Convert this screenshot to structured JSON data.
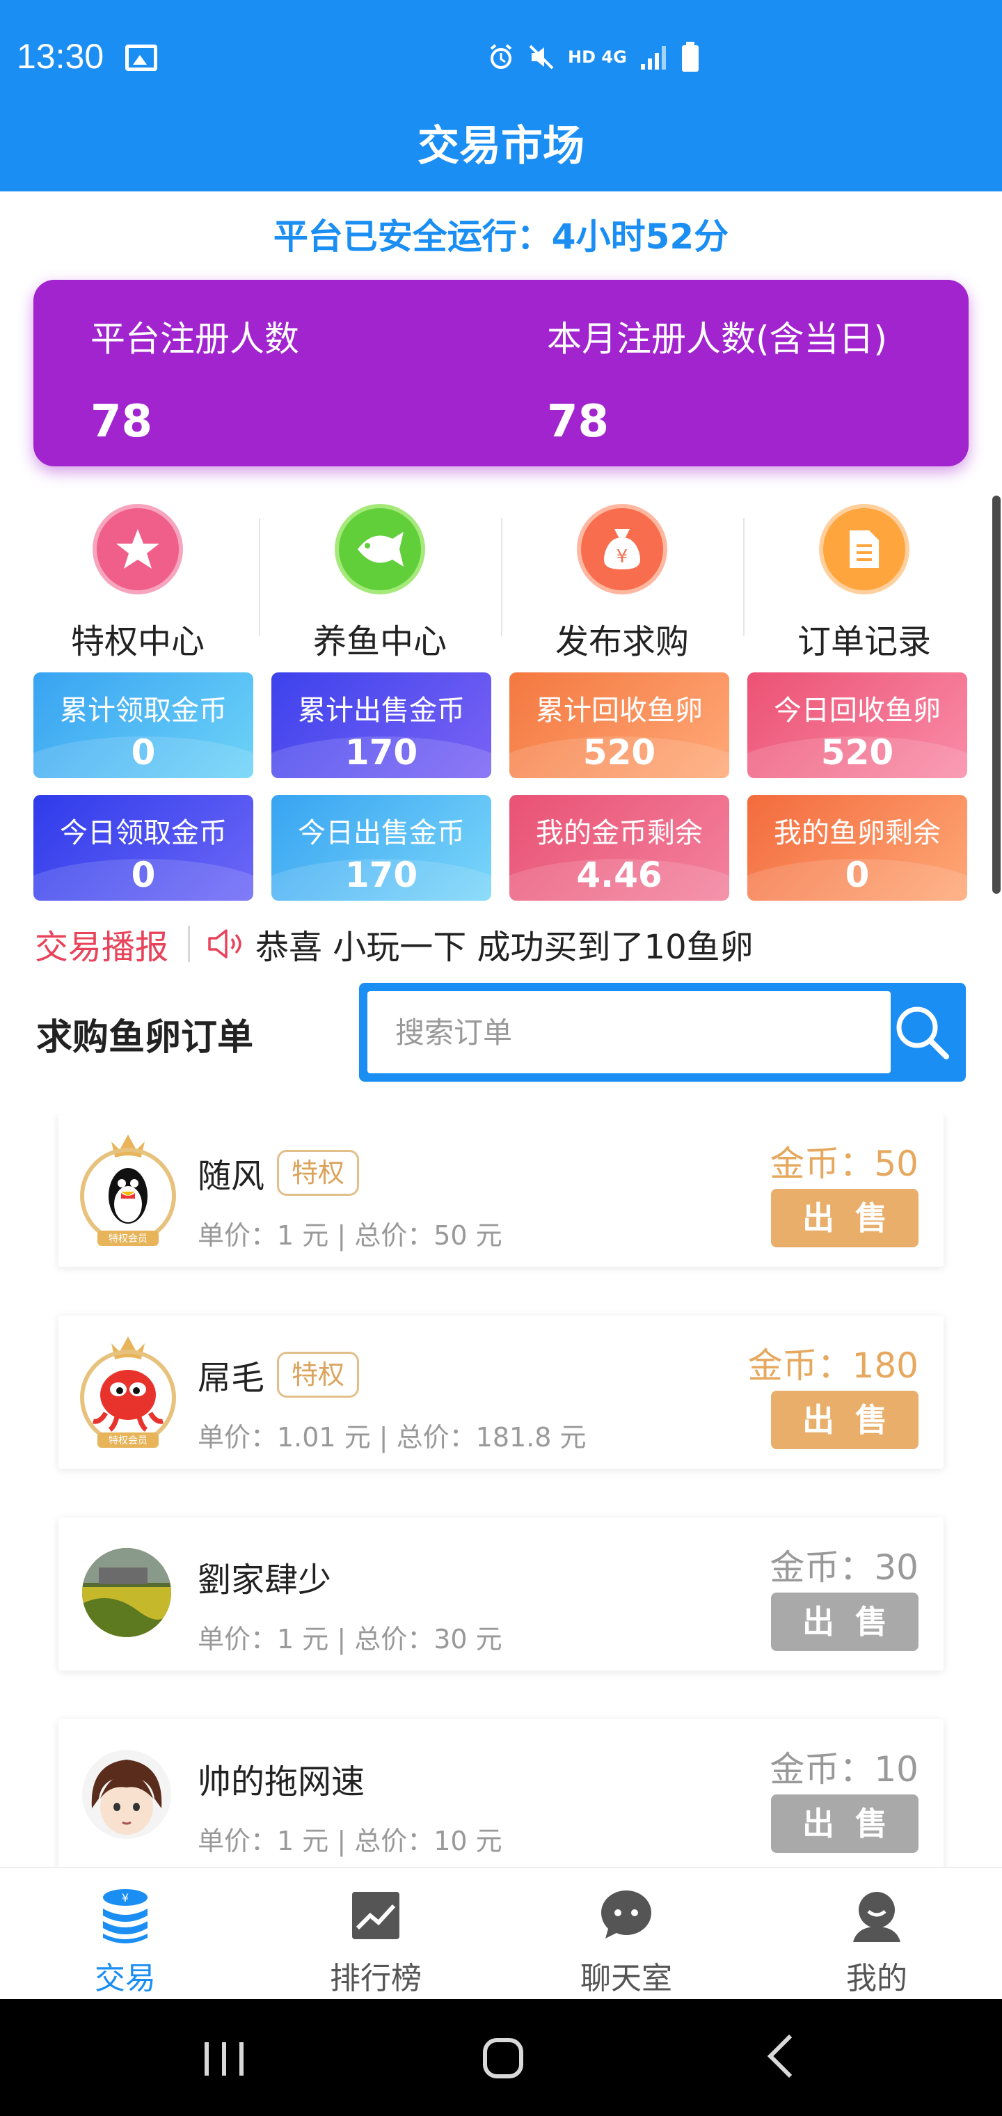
{
  "status_bar": {
    "time": "13:30",
    "network": "HD 4G"
  },
  "header": {
    "title": "交易市场"
  },
  "runtime": {
    "text": "平台已安全运行：4小时52分"
  },
  "stats": {
    "total_label": "平台注册人数",
    "total_value": "78",
    "month_label": "本月注册人数(含当日)",
    "month_value": "78"
  },
  "quick_nav": [
    {
      "label": "特权中心",
      "icon": "star-icon",
      "color": "#ef5f8a"
    },
    {
      "label": "养鱼中心",
      "icon": "fish-icon",
      "color": "#61cf3a"
    },
    {
      "label": "发布求购",
      "icon": "money-bag-icon",
      "color": "#f76d4e"
    },
    {
      "label": "订单记录",
      "icon": "document-icon",
      "color": "#ffa53d"
    }
  ],
  "tiles": [
    {
      "label": "累计领取金币",
      "value": "0"
    },
    {
      "label": "累计出售金币",
      "value": "170"
    },
    {
      "label": "累计回收鱼卵",
      "value": "520"
    },
    {
      "label": "今日回收鱼卵",
      "value": "520"
    },
    {
      "label": "今日领取金币",
      "value": "0"
    },
    {
      "label": "今日出售金币",
      "value": "170"
    },
    {
      "label": "我的金币剩余",
      "value": "4.46"
    },
    {
      "label": "我的鱼卵剩余",
      "value": "0"
    }
  ],
  "broadcast": {
    "title": "交易播报",
    "message": "恭喜 小玩一下 成功买到了10鱼卵"
  },
  "orders_section": {
    "title": "求购鱼卵订单",
    "search_placeholder": "搜索订单"
  },
  "orders": [
    {
      "name": "随风",
      "badge": "特权",
      "price_text": "单价：1 元 | 总价：50 元",
      "coin_text": "金币：50",
      "button": "出售",
      "vip": true
    },
    {
      "name": "屌毛",
      "badge": "特权",
      "price_text": "单价：1.01 元 | 总价：181.8 元",
      "coin_text": "金币：180",
      "button": "出售",
      "vip": true
    },
    {
      "name": "劉家肆少",
      "badge": "",
      "price_text": "单价：1 元 | 总价：30 元",
      "coin_text": "金币：30",
      "button": "出售",
      "vip": false
    },
    {
      "name": "帅的拖网速",
      "badge": "",
      "price_text": "单价：1 元 | 总价：10 元",
      "coin_text": "金币：10",
      "button": "出售",
      "vip": false
    }
  ],
  "tabs": [
    {
      "label": "交易",
      "icon": "coin-stack-icon",
      "active": true
    },
    {
      "label": "排行榜",
      "icon": "trend-chart-icon",
      "active": false
    },
    {
      "label": "聊天室",
      "icon": "chat-bubble-icon",
      "active": false
    },
    {
      "label": "我的",
      "icon": "profile-icon",
      "active": false
    }
  ],
  "colors": {
    "primary": "#1a8ef3",
    "stats_card": "#a124cf",
    "broadcast_title": "#e8435a",
    "vip_gold": "#e8ae6a",
    "disabled_gray": "#a9a9a9"
  }
}
